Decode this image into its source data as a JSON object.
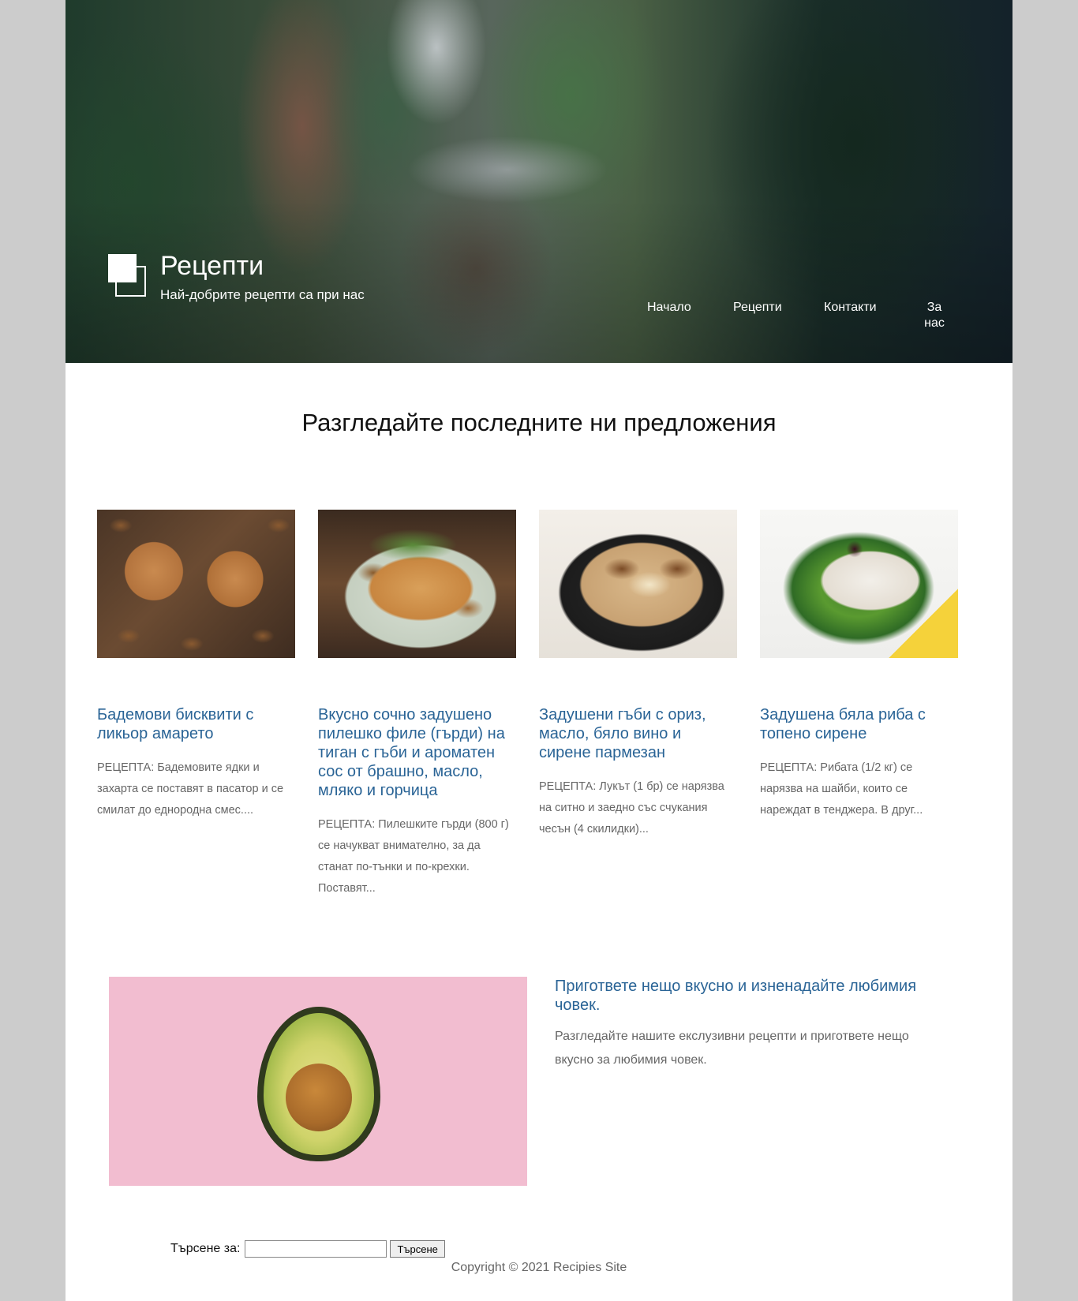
{
  "header": {
    "title": "Рецепти",
    "tagline": "Най-добрите рецепти са при нас"
  },
  "nav": {
    "items": [
      {
        "label": "Начало"
      },
      {
        "label": "Рецепти"
      },
      {
        "label": "Контакти"
      },
      {
        "label": "За нас"
      }
    ]
  },
  "main": {
    "heading": "Разгледайте последните ни предложения",
    "recipes": [
      {
        "title": "Бадемови бисквити с ликьор амарето",
        "excerpt": "РЕЦЕПТА: Бадемовите ядки и захарта се поставят в пасатор и се смилат до еднородна смес...."
      },
      {
        "title": "Вкусно сочно задушено пилешко филе (гърди) на тиган с гъби и ароматен сос от брашно, масло, мляко и горчица",
        "excerpt": "РЕЦЕПТА: Пилешките гърди (800 г) се начукват внимателно, за да станат по-тънки и по-крехки. Поставят..."
      },
      {
        "title": "Задушени гъби с ориз, масло, бяло вино и сирене пармезан",
        "excerpt": "РЕЦЕПТА: Лукът (1 бр) се нарязва на ситно и заедно със счукания чесън (4 скилидки)..."
      },
      {
        "title": "Задушена бяла риба с топено сирене",
        "excerpt": "РЕЦЕПТА: Рибата (1/2 кг) се нарязва на шайби, които се нареждат в тенджера. В друг..."
      }
    ]
  },
  "feature": {
    "title": "Пригответе нещо вкусно и изненадайте любимия човек.",
    "text": "Разгледайте нашите екслузивни рецепти и пригответе нещо вкусно за любимия човек."
  },
  "footer": {
    "search_label": "Търсене за:",
    "search_value": "",
    "search_button": "Търсене",
    "copyright": "Copyright © 2021 Recipies Site"
  },
  "colors": {
    "link": "#2a6496",
    "muted_text": "#666666",
    "outer_background": "#cccccc"
  }
}
